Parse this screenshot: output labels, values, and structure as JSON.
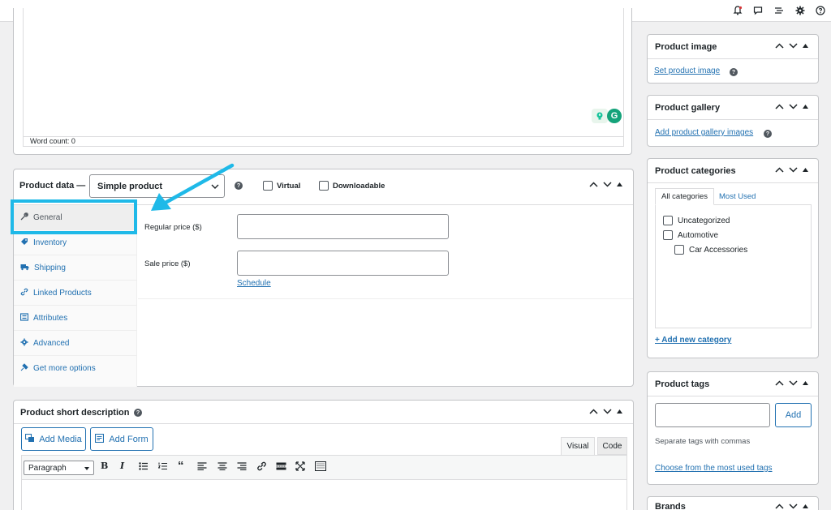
{
  "editor": {
    "word_count": "Word count: 0"
  },
  "product_data": {
    "label": "Product data —",
    "type_select": "Simple product",
    "virtual_label": "Virtual",
    "downloadable_label": "Downloadable",
    "tabs": [
      {
        "label": "General"
      },
      {
        "label": "Inventory"
      },
      {
        "label": "Shipping"
      },
      {
        "label": "Linked Products"
      },
      {
        "label": "Attributes"
      },
      {
        "label": "Advanced"
      },
      {
        "label": "Get more options"
      }
    ],
    "regular_price_label": "Regular price ($)",
    "sale_price_label": "Sale price ($)",
    "schedule_link": "Schedule"
  },
  "short_description": {
    "title": "Product short description",
    "add_media": "Add Media",
    "add_form": "Add Form",
    "tab_visual": "Visual",
    "tab_code": "Code",
    "format_select": "Paragraph"
  },
  "sidebar": {
    "product_image": {
      "title": "Product image",
      "link": "Set product image"
    },
    "product_gallery": {
      "title": "Product gallery",
      "link": "Add product gallery images"
    },
    "product_categories": {
      "title": "Product categories",
      "tab_all": "All categories",
      "tab_most_used": "Most Used",
      "items": [
        {
          "label": "Uncategorized"
        },
        {
          "label": "Automotive"
        },
        {
          "label": "Car Accessories"
        }
      ],
      "add_link": "+ Add new category"
    },
    "product_tags": {
      "title": "Product tags",
      "add_button": "Add",
      "hint": "Separate tags with commas",
      "choose_link": "Choose from the most used tags"
    },
    "brands": {
      "title": "Brands"
    }
  },
  "colors": {
    "accent": "#2271b1",
    "highlight": "#1fb9e8"
  }
}
